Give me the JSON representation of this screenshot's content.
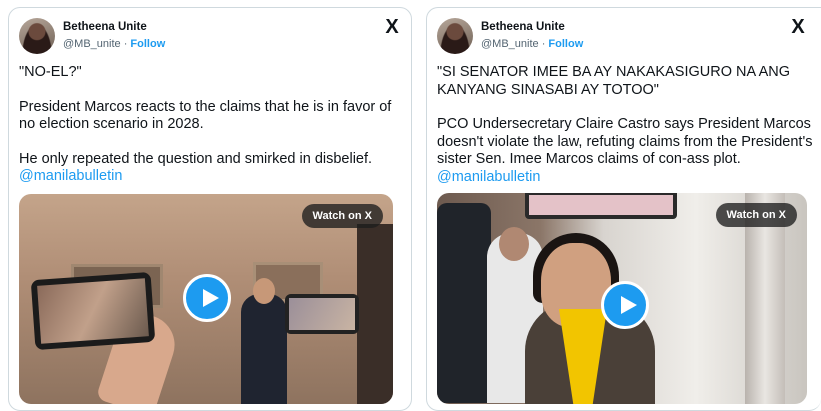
{
  "posts": [
    {
      "author": "Betheena Unite",
      "handle": "@MB_unite",
      "separator": " · ",
      "follow": "Follow",
      "logo": "X",
      "lines": [
        "\"NO-EL?\"",
        "President Marcos reacts to the claims that he is in favor of no election scenario in 2028.",
        "He only repeated the question and smirked in disbelief."
      ],
      "mention": "@manilabulletin",
      "video_button": "Watch on X"
    },
    {
      "author": "Betheena Unite",
      "handle": "@MB_unite",
      "separator": " · ",
      "follow": "Follow",
      "logo": "X",
      "lines": [
        "\"SI SENATOR IMEE BA AY NAKAKASIGURO NA ANG KANYANG SINASABI AY TOTOO\"",
        "PCO Undersecretary Claire Castro says President Marcos doesn't violate the law, refuting claims from the President's sister Sen. Imee Marcos claims of con-ass plot."
      ],
      "mention": "@manilabulletin",
      "video_button": "Watch on X"
    }
  ],
  "colors": {
    "link": "#1d9bf0",
    "text": "#0f1419",
    "muted": "#536471",
    "border": "#cfd9de"
  },
  "icons": {
    "logo": "x-logo-icon",
    "play": "play-icon"
  }
}
